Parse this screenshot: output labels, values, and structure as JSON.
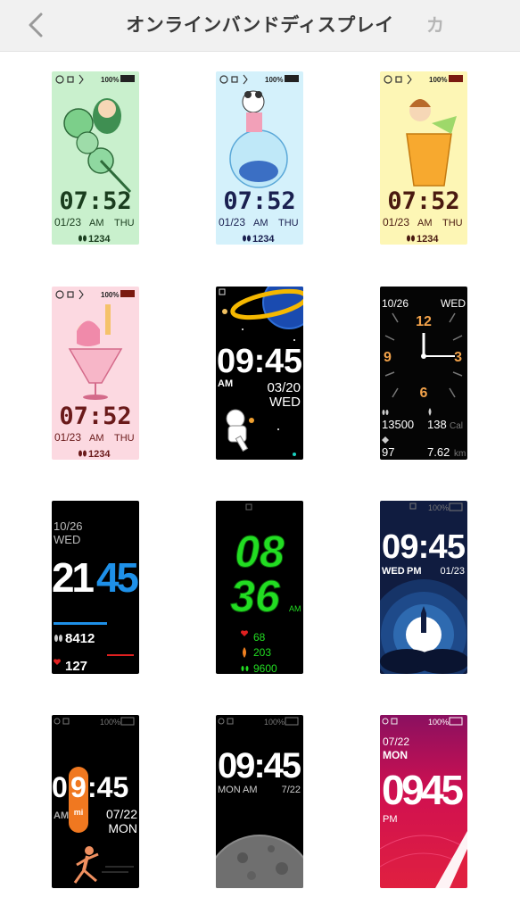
{
  "header": {
    "title": "オンラインバンドディスプレイ",
    "right_action": "カ"
  },
  "faces": [
    {
      "battery": "100%",
      "time": "07:52",
      "date": "01/23",
      "ampm": "AM",
      "day": "THU",
      "steps": "1234",
      "bg": "#c9f0cd",
      "accent": "#1a3d1e"
    },
    {
      "battery": "100%",
      "time": "07:52",
      "date": "01/23",
      "ampm": "AM",
      "day": "THU",
      "steps": "1234",
      "bg": "#d4f1fb",
      "accent": "#1a2050"
    },
    {
      "battery": "100%",
      "time": "07:52",
      "date": "01/23",
      "ampm": "AM",
      "day": "THU",
      "steps": "1234",
      "bg": "#fdf6b5",
      "accent": "#4a1a10"
    },
    {
      "battery": "100%",
      "time": "07:52",
      "date": "01/23",
      "ampm": "AM",
      "day": "THU",
      "steps": "1234",
      "bg": "#fcd9e1",
      "accent": "#6a1a1a"
    },
    {
      "time": "09:45",
      "ampm": "AM",
      "date": "03/20",
      "day": "WED"
    },
    {
      "date": "10/26",
      "day": "WED",
      "steps": "13500",
      "calories": "138",
      "calories_unit": "Cal",
      "heart": "97",
      "distance": "7.62",
      "distance_unit": "km",
      "n12": "12",
      "n3": "3",
      "n6": "6",
      "n9": "9"
    },
    {
      "date": "10/26",
      "day": "WED",
      "hour": "21",
      "minute": "45",
      "steps": "8412",
      "heart": "127"
    },
    {
      "hour": "08",
      "minute": "36",
      "ampm": "AM",
      "heart": "68",
      "calories": "203",
      "steps": "9600"
    },
    {
      "battery": "100%",
      "time": "09:45",
      "day": "WED",
      "ampm": "PM",
      "date": "01/23"
    },
    {
      "battery": "100%",
      "hour_digit": "9",
      "time_rest": ":45",
      "lead_digit": "0",
      "logo": "mi",
      "ampm": "AM",
      "date": "07/22",
      "day": "MON"
    },
    {
      "battery": "100%",
      "time": "09:45",
      "day": "MON",
      "ampm": "AM",
      "date": "7/22"
    },
    {
      "battery": "100%",
      "date": "07/22",
      "day": "MON",
      "time": "0945",
      "ampm": "PM"
    }
  ]
}
